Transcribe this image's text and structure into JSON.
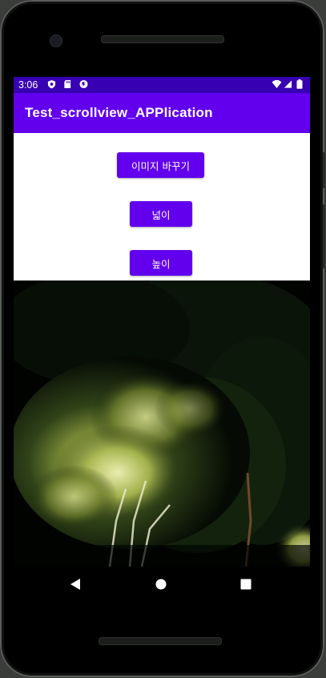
{
  "status_bar": {
    "time": "3:06",
    "left_icons": [
      "shield-icon",
      "sd-card-icon",
      "location-icon"
    ],
    "right_icons": [
      "wifi-icon",
      "signal-icon",
      "battery-icon"
    ],
    "color": "#3700b3"
  },
  "app_bar": {
    "title": "Test_scrollview_APPlication",
    "color": "#6200ee"
  },
  "buttons": {
    "change_image": "이미지 바꾸기",
    "width": "넓이",
    "height": "높이"
  },
  "main": {
    "image": "night-tree-photo"
  },
  "nav_bar": {
    "icons": [
      "back-icon",
      "home-icon",
      "recents-icon"
    ]
  }
}
